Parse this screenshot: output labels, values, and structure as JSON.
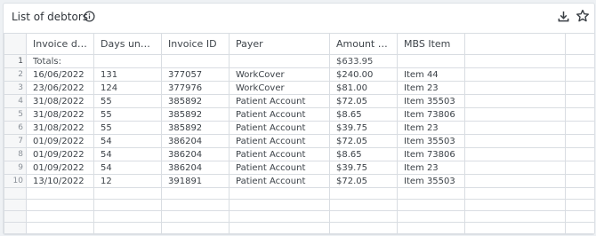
{
  "widget": {
    "title": "List of debtors",
    "info_icon": "info-circle-icon",
    "download_icon": "download-icon",
    "favorite_icon": "star-icon"
  },
  "table": {
    "columns": [
      "Invoice date",
      "Days unpaid",
      "Invoice ID",
      "Payer",
      "Amount o...",
      "MBS Item",
      "",
      ""
    ],
    "totals": {
      "row_number": "1",
      "label": "Totals:",
      "amount": "$633.95"
    },
    "rows": [
      {
        "n": "2",
        "invoice_date": "16/06/2022",
        "days_unpaid": "131",
        "invoice_id": "377057",
        "payer": "WorkCover",
        "amount": "$240.00",
        "mbs_item": "Item 44"
      },
      {
        "n": "3",
        "invoice_date": "23/06/2022",
        "days_unpaid": "124",
        "invoice_id": "377976",
        "payer": "WorkCover",
        "amount": "$81.00",
        "mbs_item": "Item 23"
      },
      {
        "n": "4",
        "invoice_date": "31/08/2022",
        "days_unpaid": "55",
        "invoice_id": "385892",
        "payer": "Patient Account",
        "amount": "$72.05",
        "mbs_item": "Item 35503"
      },
      {
        "n": "5",
        "invoice_date": "31/08/2022",
        "days_unpaid": "55",
        "invoice_id": "385892",
        "payer": "Patient Account",
        "amount": "$8.65",
        "mbs_item": "Item 73806"
      },
      {
        "n": "6",
        "invoice_date": "31/08/2022",
        "days_unpaid": "55",
        "invoice_id": "385892",
        "payer": "Patient Account",
        "amount": "$39.75",
        "mbs_item": "Item 23"
      },
      {
        "n": "7",
        "invoice_date": "01/09/2022",
        "days_unpaid": "54",
        "invoice_id": "386204",
        "payer": "Patient Account",
        "amount": "$72.05",
        "mbs_item": "Item 35503"
      },
      {
        "n": "8",
        "invoice_date": "01/09/2022",
        "days_unpaid": "54",
        "invoice_id": "386204",
        "payer": "Patient Account",
        "amount": "$8.65",
        "mbs_item": "Item 73806"
      },
      {
        "n": "9",
        "invoice_date": "01/09/2022",
        "days_unpaid": "54",
        "invoice_id": "386204",
        "payer": "Patient Account",
        "amount": "$39.75",
        "mbs_item": "Item 23"
      },
      {
        "n": "10",
        "invoice_date": "13/10/2022",
        "days_unpaid": "12",
        "invoice_id": "391891",
        "payer": "Patient Account",
        "amount": "$72.05",
        "mbs_item": "Item 35503"
      }
    ]
  }
}
